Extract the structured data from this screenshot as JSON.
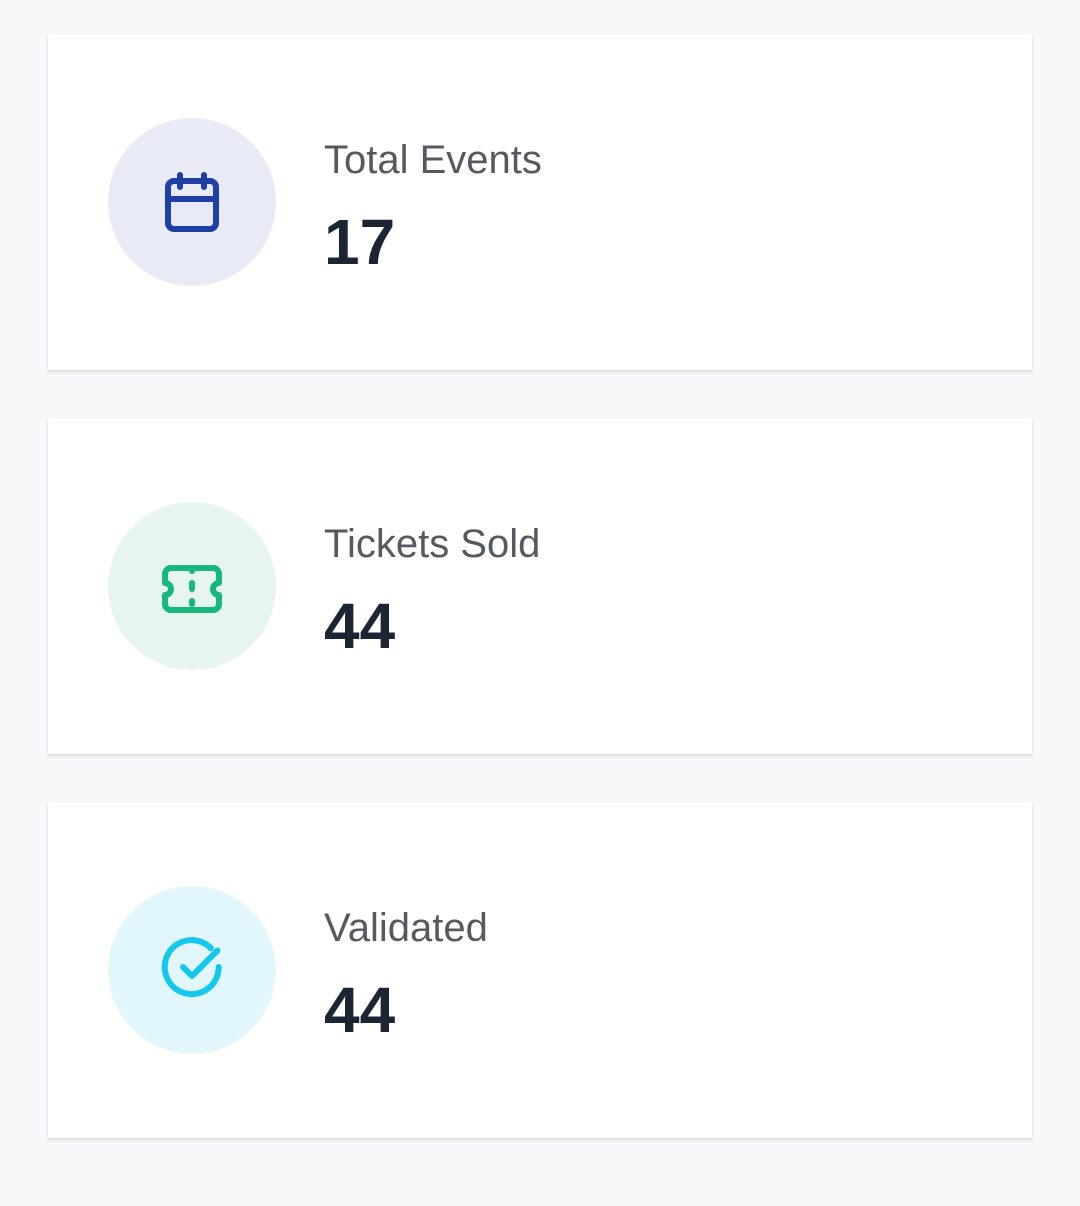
{
  "stats": [
    {
      "label": "Total Events",
      "value": "17",
      "icon": "calendar-icon",
      "icon_color": "#1f3fa6",
      "circle_color": "#e8ebf6"
    },
    {
      "label": "Tickets Sold",
      "value": "44",
      "icon": "ticket-icon",
      "icon_color": "#16b87e",
      "circle_color": "#e6f6ef"
    },
    {
      "label": "Validated",
      "value": "44",
      "icon": "check-circle-icon",
      "icon_color": "#14c8ec",
      "circle_color": "#e2f7fc"
    }
  ]
}
